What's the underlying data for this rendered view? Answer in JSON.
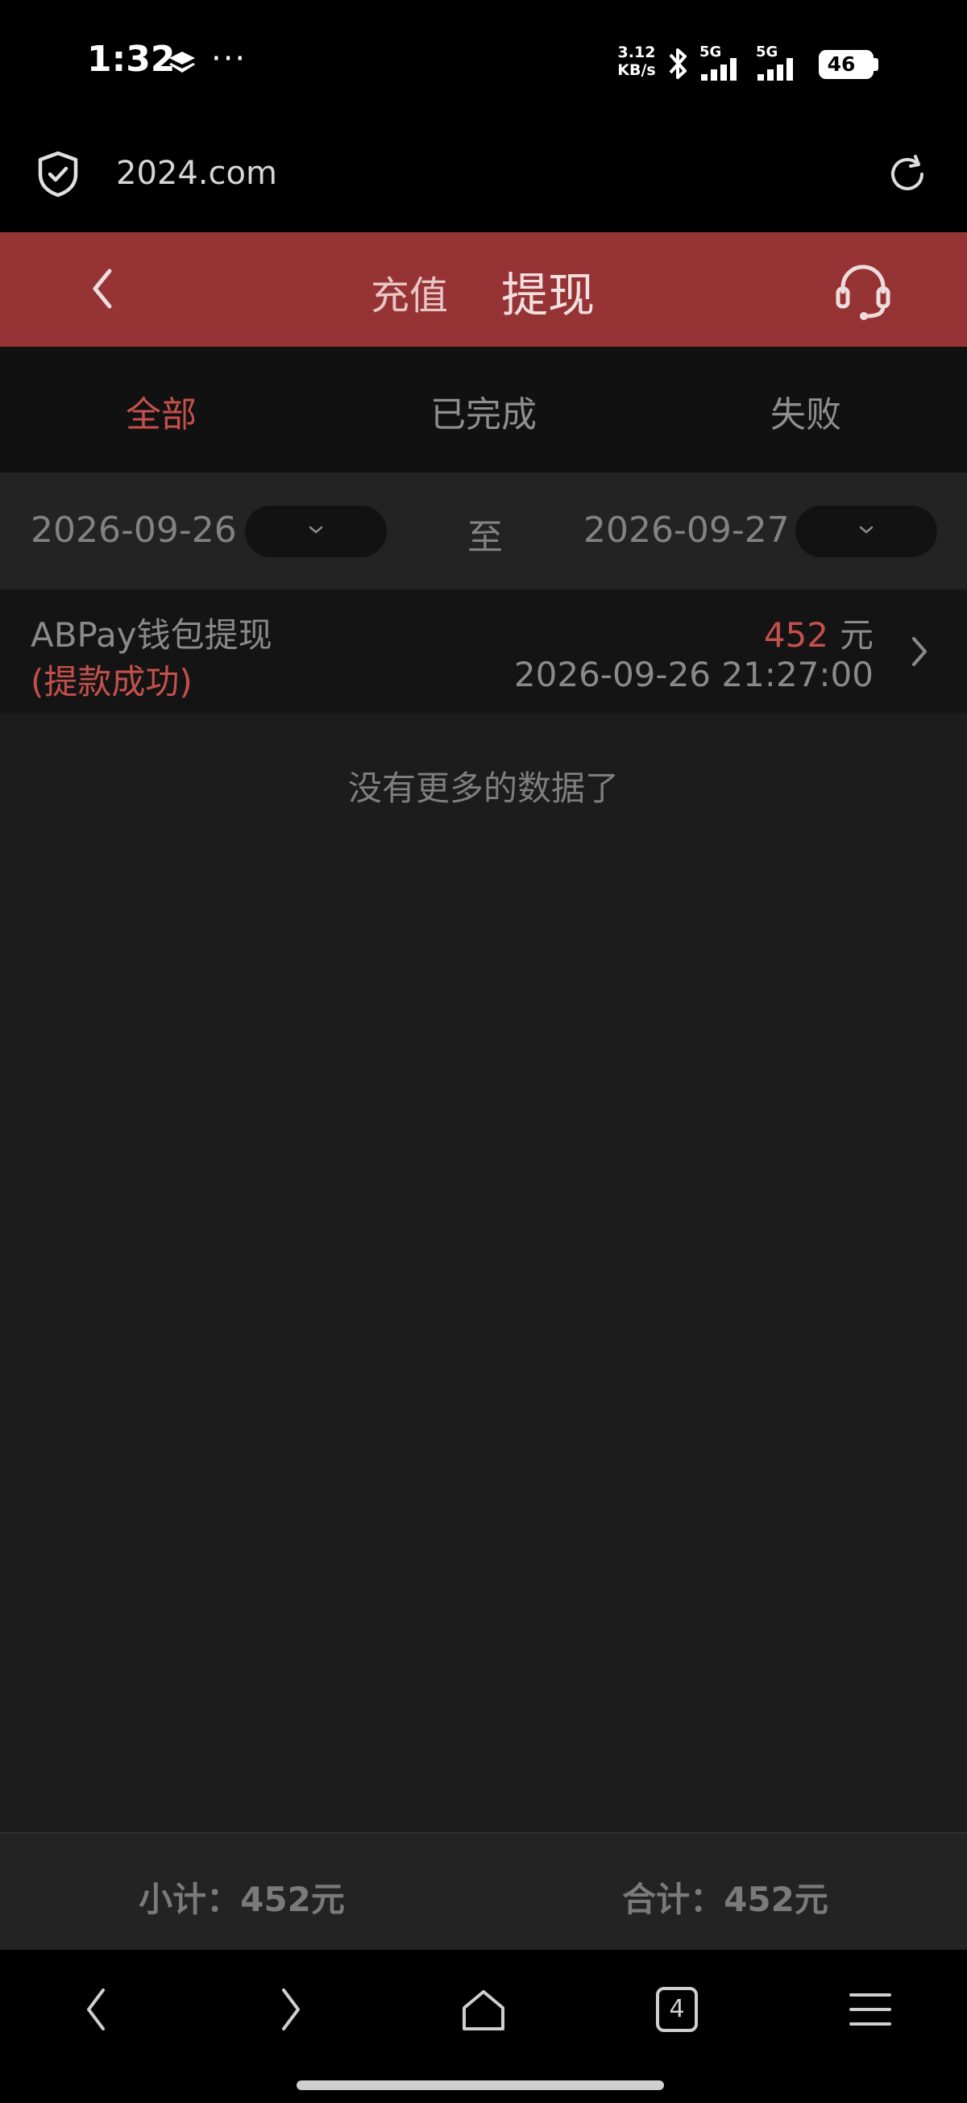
{
  "status_bar": {
    "time": "1:32",
    "network_speed_value": "3.12",
    "network_speed_unit": "KB/s",
    "signal1_label": "5G",
    "signal2_label": "5G",
    "battery": "46",
    "icons": [
      "layers-icon",
      "more-dots-icon",
      "bluetooth-icon",
      "signal-icon",
      "signal-icon",
      "battery-icon"
    ]
  },
  "browser": {
    "url": "2024.com",
    "icons": [
      "shield-check-icon",
      "reload-icon"
    ],
    "tab_count": "4"
  },
  "header": {
    "tab_recharge": "充值",
    "tab_withdraw": "提现",
    "active_tab": "提现",
    "accent": "#963435"
  },
  "filters": {
    "tabs": [
      "全部",
      "已完成",
      "失败"
    ],
    "active": "全部",
    "active_color": "#c4504c"
  },
  "date_range": {
    "start": "2026-09-26",
    "separator": "至",
    "end": "2026-09-27"
  },
  "records": [
    {
      "title": "ABPay钱包提现",
      "status": "(提款成功)",
      "amount": "452",
      "unit": "元",
      "time": "2026-09-26 21:27:00"
    }
  ],
  "no_more_text": "没有更多的数据了",
  "summary": {
    "subtotal": "小计：452元",
    "total": "合计：452元"
  }
}
